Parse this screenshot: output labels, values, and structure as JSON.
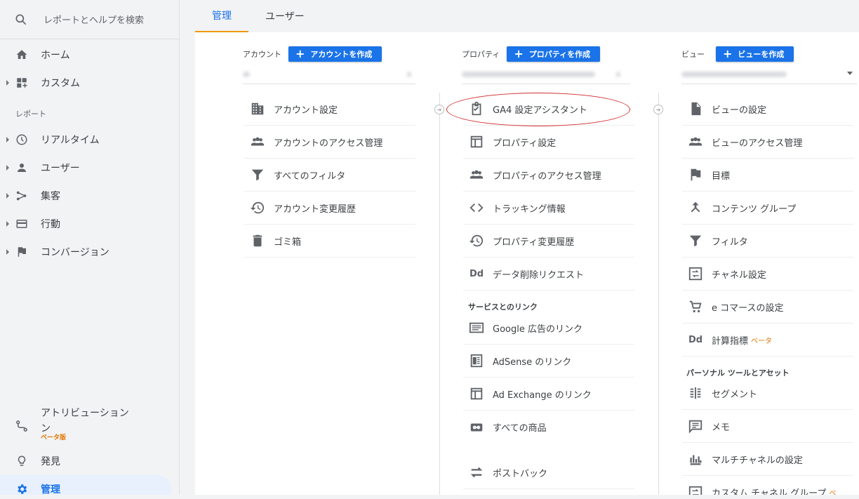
{
  "search": {
    "placeholder": "レポートとヘルプを検索"
  },
  "sidebar": {
    "home": "ホーム",
    "custom": "カスタム",
    "reports_label": "レポート",
    "realtime": "リアルタイム",
    "audience": "ユーザー",
    "acquisition": "集客",
    "behavior": "行動",
    "conversions": "コンバージョン",
    "attribution": "アトリビューション",
    "attribution_beta": "ベータ版",
    "discover": "発見",
    "admin": "管理"
  },
  "tabs": {
    "admin": "管理",
    "user": "ユーザー"
  },
  "account_col": {
    "heading": "アカウント",
    "create": "アカウントを作成",
    "items": [
      "アカウント設定",
      "アカウントのアクセス管理",
      "すべてのフィルタ",
      "アカウント変更履歴",
      "ゴミ箱"
    ]
  },
  "property_col": {
    "heading": "プロパティ",
    "create": "プロパティを作成",
    "items": [
      "GA4 設定アシスタント",
      "プロパティ設定",
      "プロパティのアクセス管理",
      "トラッキング情報",
      "プロパティ変更履歴",
      "データ削除リクエスト"
    ],
    "links_heading": "サービスとのリンク",
    "links": [
      "Google 広告のリンク",
      "AdSense のリンク",
      "Ad Exchange のリンク",
      "すべての商品",
      "ポストバック"
    ]
  },
  "view_col": {
    "heading": "ビュー",
    "create": "ビューを作成",
    "items": [
      "ビューの設定",
      "ビューのアクセス管理",
      "目標",
      "コンテンツ グループ",
      "フィルタ",
      "チャネル設定",
      "e コマースの設定",
      "計算指標"
    ],
    "calc_beta": "ベータ",
    "personal_heading": "パーソナル ツールとアセット",
    "personal": [
      "セグメント",
      "メモ",
      "マルチチャネルの設定",
      "カスタム チャネル グループ"
    ],
    "custom_channel_beta": "ベ"
  },
  "dd_text": "Dd",
  "colors": {
    "accent": "#1a73e8",
    "tab_underline": "#f29900",
    "beta": "#e37400",
    "highlight": "#d32f2f"
  }
}
